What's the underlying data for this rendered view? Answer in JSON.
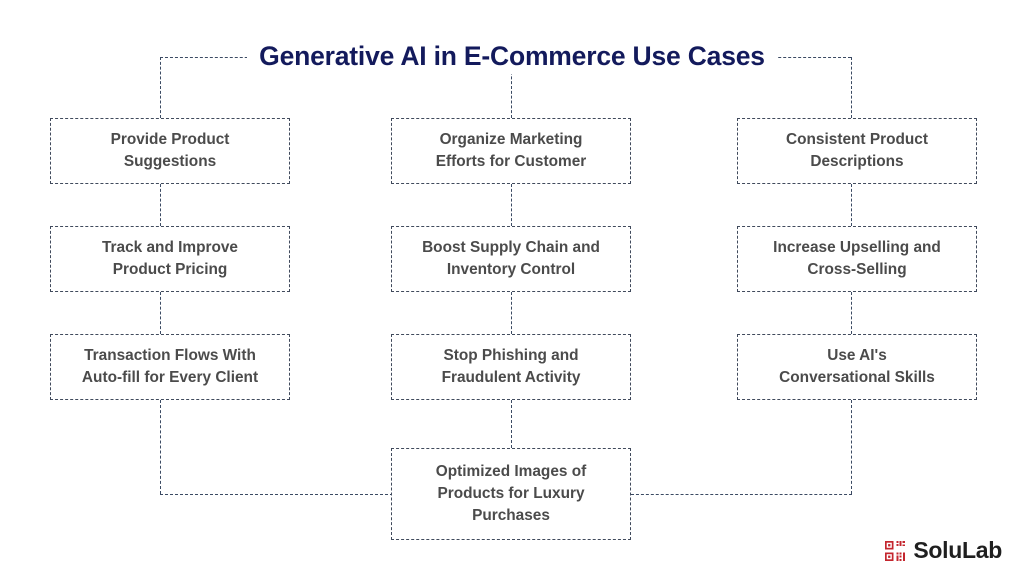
{
  "title": "Generative AI in E-Commerce Use Cases",
  "colors": {
    "title": "#131a5c",
    "node_text": "#4b4b4b",
    "connector": "#3b4a63",
    "node_border": "#404a5c",
    "logo_mark": "#c4262e",
    "logo_text": "#1f1f1f",
    "background": "#ffffff"
  },
  "columns": [
    {
      "name": "left",
      "nodes": [
        {
          "id": "provide-product-suggestions",
          "label": "Provide Product\nSuggestions"
        },
        {
          "id": "track-and-improve-product-pricing",
          "label": "Track and Improve\nProduct Pricing"
        },
        {
          "id": "transaction-flows-with-auto-fill",
          "label": "Transaction Flows With\nAuto-fill for Every Client"
        }
      ]
    },
    {
      "name": "center",
      "nodes": [
        {
          "id": "organize-marketing-efforts",
          "label": "Organize Marketing\nEfforts for Customer"
        },
        {
          "id": "boost-supply-chain",
          "label": "Boost Supply Chain and\nInventory Control"
        },
        {
          "id": "stop-phishing-fraud",
          "label": "Stop Phishing and\nFraudulent Activity"
        }
      ]
    },
    {
      "name": "right",
      "nodes": [
        {
          "id": "consistent-product-descriptions",
          "label": "Consistent Product\nDescriptions"
        },
        {
          "id": "increase-upselling-cross-selling",
          "label": "Increase Upselling and\nCross-Selling"
        },
        {
          "id": "use-ai-conversational-skills",
          "label": "Use AI's\nConversational Skills"
        }
      ]
    }
  ],
  "bottom_node": {
    "id": "optimized-images-luxury",
    "label": "Optimized Images of\nProducts for Luxury\nPurchases"
  },
  "logo": {
    "text": "SoluLab",
    "mark": "solulab-qr-mark-icon"
  }
}
